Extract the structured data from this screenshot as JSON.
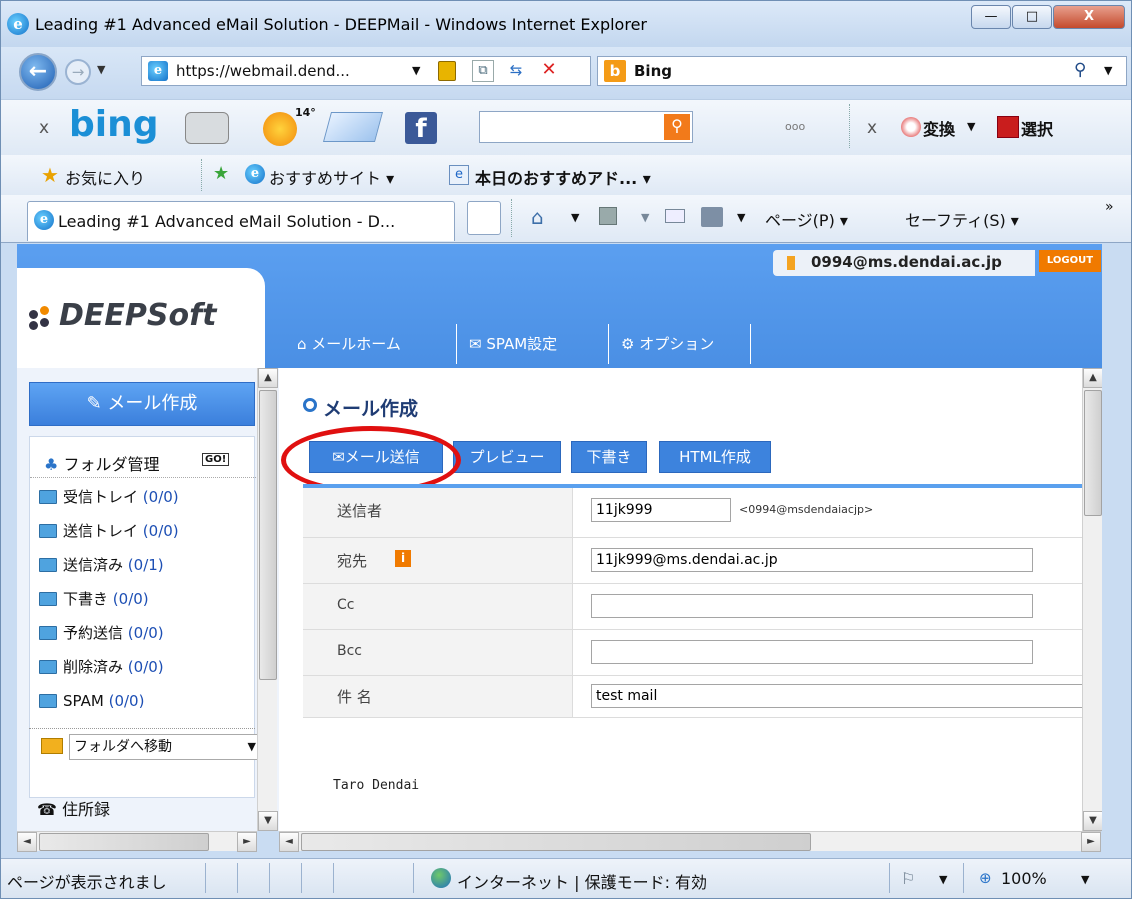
{
  "window": {
    "title": "Leading #1 Advanced eMail Solution - DEEPMail - Windows Internet Explorer",
    "minimize": "—",
    "maximize": "□",
    "close": "X"
  },
  "address_bar": {
    "url": "https://webmail.dend...",
    "search_provider": "Bing",
    "search_icon": "search-icon"
  },
  "bing_toolbar": {
    "close": "x",
    "logo": "bing",
    "weather": "14°",
    "dots": "ooo",
    "henkan": "変換",
    "sentaku": "選択"
  },
  "favorites_bar": {
    "favorites": "お気に入り",
    "recommended_sites": "おすすめサイト ▾",
    "recommended_addons": "本日のおすすめアド... ▾"
  },
  "tab": {
    "label": "Leading #1 Advanced eMail Solution - D...",
    "page_menu": "ページ(P) ▾",
    "safety_menu": "セーフティ(S) ▾",
    "chevron": "»"
  },
  "app": {
    "user_email": "0994@ms.dendai.ac.jp",
    "logout": "LOGOUT",
    "logo_text": "DEEPSoft",
    "nav": [
      "メールホーム",
      "SPAM設定",
      "オプション"
    ]
  },
  "sidebar": {
    "compose": "メール作成",
    "folder_manage": "フォルダ管理",
    "go": "GO!",
    "folders": [
      {
        "name": "受信トレイ",
        "count": "(0/0)"
      },
      {
        "name": "送信トレイ",
        "count": "(0/0)"
      },
      {
        "name": "送信済み",
        "count": "(0/1)"
      },
      {
        "name": "下書き",
        "count": "(0/0)"
      },
      {
        "name": "予約送信",
        "count": "(0/0)"
      },
      {
        "name": "削除済み",
        "count": "(0/0)"
      },
      {
        "name": "SPAM",
        "count": "(0/0)"
      }
    ],
    "move_select": "フォルダへ移動",
    "address_book": "住所録"
  },
  "compose": {
    "heading": "メール作成",
    "buttons": [
      "メール送信",
      "プレビュー",
      "下書き",
      "HTML作成"
    ],
    "fields": {
      "sender_label": "送信者",
      "sender_value": "11jk999",
      "sender_addr": "<0994@msdendaiacjp>",
      "to_label": "宛先",
      "to_value": "11jk999@ms.dendai.ac.jp",
      "cc_label": "Cc",
      "cc_value": "",
      "bcc_label": "Bcc",
      "bcc_value": "",
      "subject_label": "件 名",
      "subject_value": "test mail"
    },
    "body_text": "Taro Dendai"
  },
  "statusbar": {
    "text": "ページが表示されまし",
    "zone": "インターネット | 保護モード: 有効",
    "zoom": "100%"
  },
  "colors": {
    "accent": "#4a8fe4",
    "highlight_circle": "#e01010",
    "orange": "#f07a00"
  }
}
